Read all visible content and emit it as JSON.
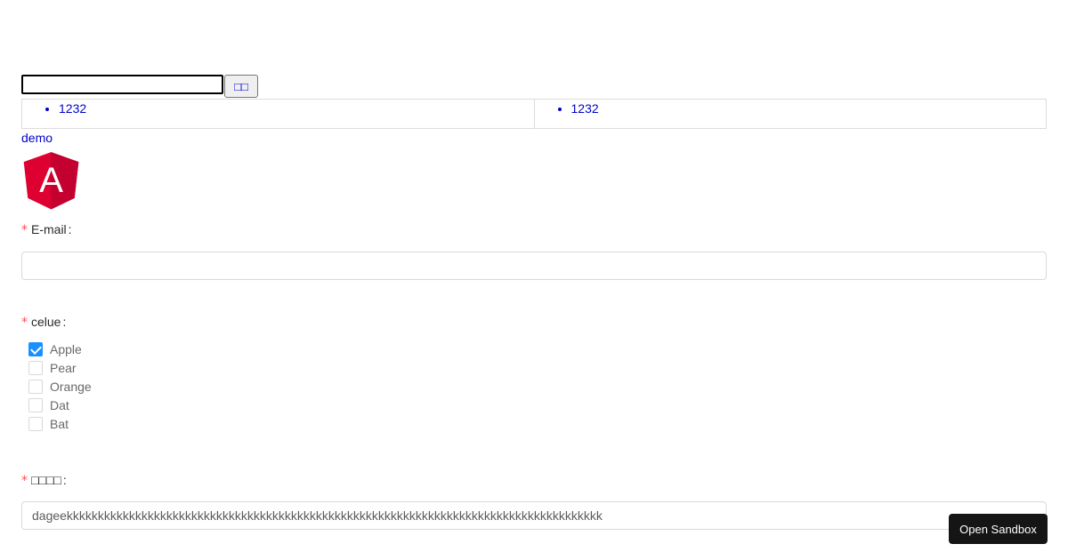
{
  "search": {
    "value": "",
    "button_label": "□□"
  },
  "results": {
    "columns": [
      {
        "items": [
          "1232"
        ]
      },
      {
        "items": [
          "1232"
        ]
      }
    ]
  },
  "demo_link": "demo",
  "logo": {
    "icon": "angular-logo-icon",
    "letter": "A",
    "color": "#dd0031"
  },
  "form": {
    "email": {
      "required": "*",
      "label": "E-mail",
      "colon": ":",
      "value": ""
    },
    "celue": {
      "required": "*",
      "label": "celue",
      "colon": ":",
      "options": [
        {
          "label": "Apple",
          "checked": true
        },
        {
          "label": "Pear",
          "checked": false
        },
        {
          "label": "Orange",
          "checked": false
        },
        {
          "label": "Dat",
          "checked": false
        },
        {
          "label": "Bat",
          "checked": false
        }
      ]
    },
    "field3": {
      "required": "*",
      "label": "□□□□",
      "colon": ":",
      "value": "dageekkkkkkkkkkkkkkkkkkkkkkkkkkkkkkkkkkkkkkkkkkkkkkkkkkkkkkkkkkkkkkkkkkkkkkkkkkkkkkkkkkkkkk"
    }
  },
  "sandbox_button": "Open Sandbox",
  "colors": {
    "accent": "#1890ff",
    "required": "#ff4d4f",
    "link": "#0000cc"
  }
}
